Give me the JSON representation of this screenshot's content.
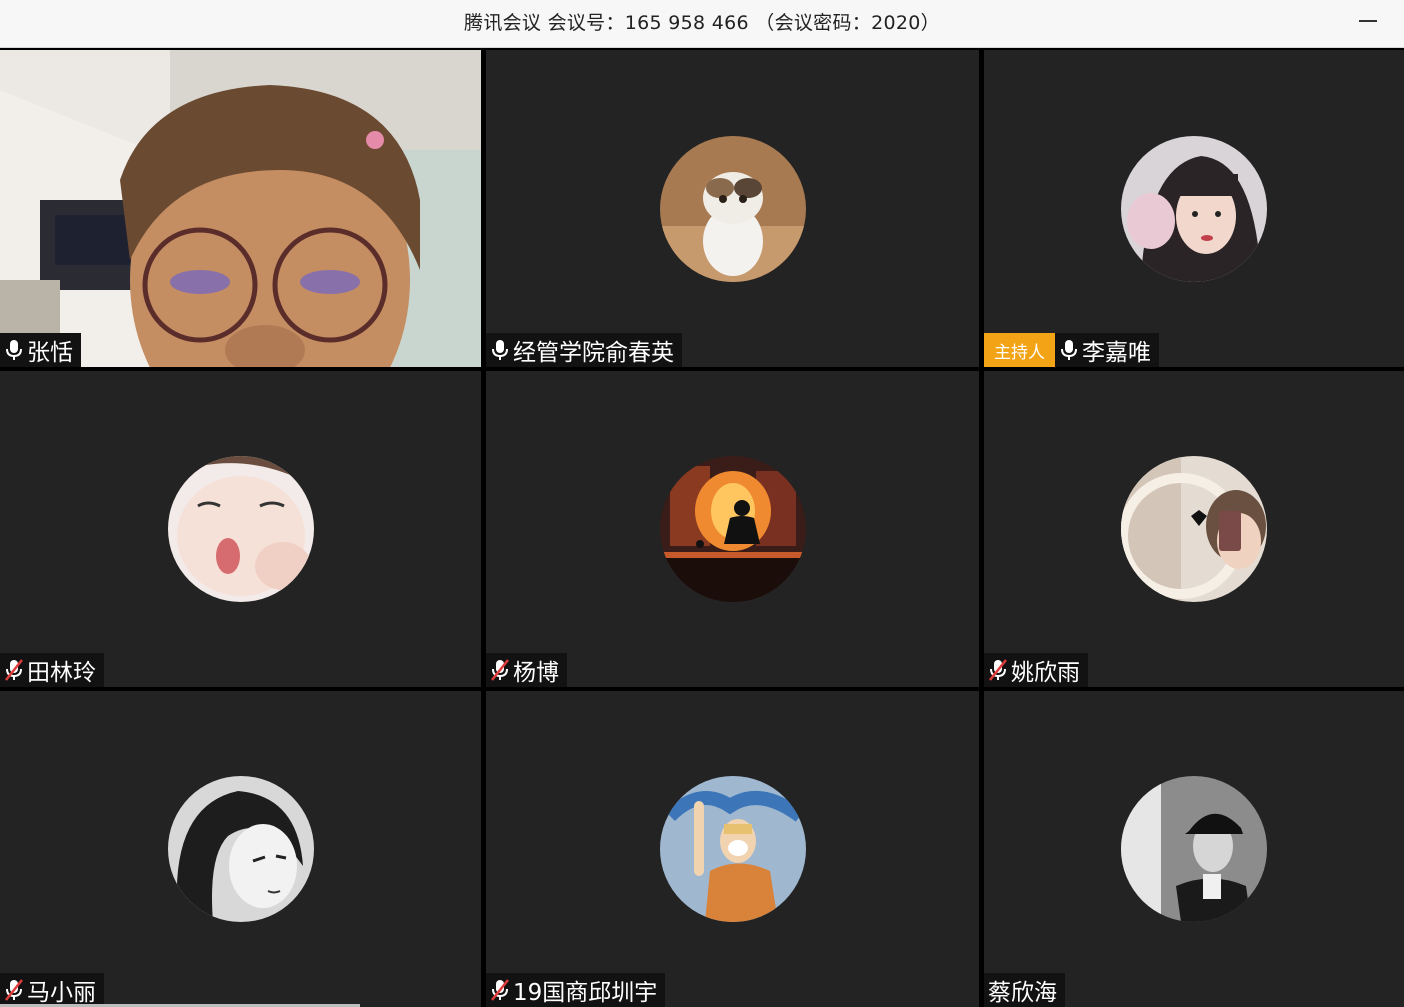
{
  "window": {
    "title": "腾讯会议 会议号：165 958 466 （会议密码：2020）",
    "minimize_icon": "minimize-icon"
  },
  "participants": [
    {
      "name": "张恬",
      "mic": "on",
      "host": false,
      "media": "video"
    },
    {
      "name": "经管学院俞春英",
      "mic": "on",
      "host": false,
      "media": "avatar",
      "avatar": "cat-avatar"
    },
    {
      "name": "李嘉唯",
      "mic": "on",
      "host": true,
      "host_label": "主持人",
      "media": "avatar",
      "avatar": "girl-selfie-avatar"
    },
    {
      "name": "田林玲",
      "mic": "muted",
      "host": false,
      "media": "avatar",
      "avatar": "baby-face-avatar"
    },
    {
      "name": "杨博",
      "mic": "muted",
      "host": false,
      "media": "avatar",
      "avatar": "city-silhouette-avatar"
    },
    {
      "name": "姚欣雨",
      "mic": "muted",
      "host": false,
      "media": "avatar",
      "avatar": "mirror-selfie-avatar"
    },
    {
      "name": "马小丽",
      "mic": "muted",
      "host": false,
      "media": "avatar",
      "avatar": "anime-girl-avatar"
    },
    {
      "name": "19国商邱圳宇",
      "mic": "muted",
      "host": false,
      "media": "avatar",
      "avatar": "cartoon-2020-avatar"
    },
    {
      "name": "蔡欣海",
      "mic": "none",
      "host": false,
      "media": "avatar",
      "avatar": "bw-portrait-avatar"
    }
  ],
  "colors": {
    "tile_bg": "#232323",
    "host_badge": "#f3a316",
    "mute_red": "#e03c3c"
  }
}
